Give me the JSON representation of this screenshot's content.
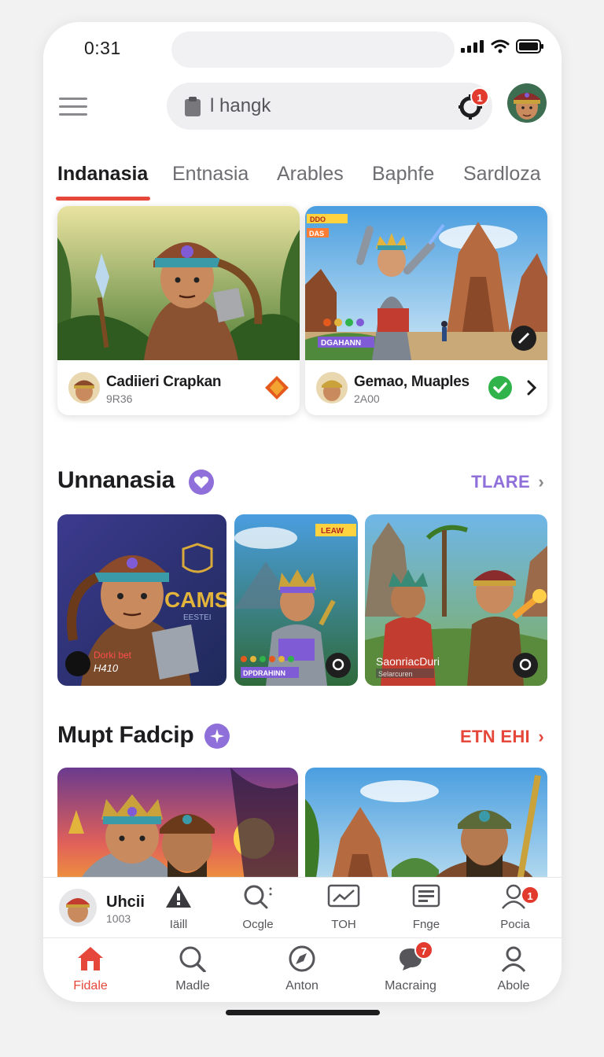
{
  "status": {
    "time": "0:31"
  },
  "search": {
    "value": "l hangk",
    "notification_count": "1"
  },
  "tabs": [
    "Indanasia",
    "Entnasia",
    "Arables",
    "Baphfe",
    "Sardloza"
  ],
  "featured": [
    {
      "title": "Cadiieri Crapkan",
      "subtitle": "9R36",
      "banner_label": "DGAHANN",
      "side_labels": [
        "DDO",
        "DAS"
      ]
    },
    {
      "title": "Gemao, Muaples",
      "subtitle": "2A00"
    }
  ],
  "section1": {
    "title": "Unnanasia",
    "link": "TLARE",
    "tiles": [
      {
        "overlay_big": "CAMS",
        "overlay_small": "EESTEI",
        "caption": "Dorki bet",
        "caption_sub": "H410"
      },
      {
        "overlay_banner": "LEAW",
        "caption": "DPDRAHINN"
      },
      {
        "caption": "SaonriacDuri",
        "caption_sub": "Selarcuren"
      }
    ]
  },
  "section2": {
    "title": "Mupt Fadcip",
    "link": "ETN EHI"
  },
  "sub_bar": {
    "player_name": "Uhcii",
    "player_id": "1003",
    "items": [
      "Iäill",
      "Ocgle",
      "TOH",
      "Fnge",
      "Pocia"
    ],
    "pocia_badge": "1"
  },
  "nav": {
    "items": [
      "Fidale",
      "Madle",
      "Anton",
      "Macraing",
      "Abole"
    ],
    "macraing_badge": "7"
  },
  "colors": {
    "accent": "#e5483a",
    "purple": "#8f6fd9",
    "green": "#2fb34a"
  }
}
